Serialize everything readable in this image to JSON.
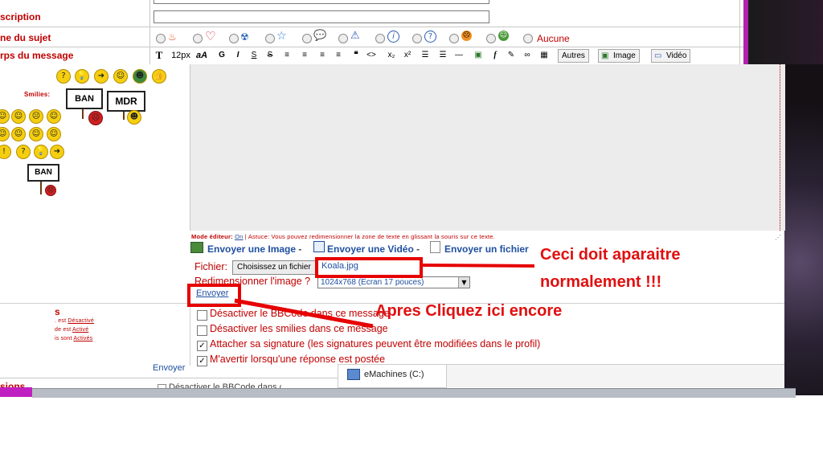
{
  "form": {
    "labels": {
      "description": "scription",
      "icon": "ne du sujet",
      "body": "rps du message",
      "smilies": "Smilies:",
      "options": "s",
      "options2": "sions"
    },
    "icon_none_label": "Aucune",
    "left_status": {
      "line1_prefix": ". est",
      "line1_link": "Désactivé",
      "line2_prefix": "de est",
      "line2_link": "Activé",
      "line3_prefix": "is sont",
      "line3_link": "Activés"
    },
    "envoyer_bottom": "Envoyer",
    "bottom_partial": "Désactiver le BBCode dans ce"
  },
  "toolbar": {
    "font_size": "12px",
    "bold": "G",
    "italic": "I",
    "underline": "S",
    "strike": "S",
    "others": "Autres",
    "image": "Image",
    "video": "Vidéo"
  },
  "smilies": {
    "ban": "BAN",
    "mdr": "MDR"
  },
  "editor": {
    "mode_label": "Mode éditeur:",
    "mode_value": "On",
    "tip": "Astuce: Vous pouvez redimensionner la zone de texte en glissant la souris sur ce texte.",
    "upload_image": "Envoyer une Image",
    "upload_video": "Envoyer une Vidéo",
    "upload_file": "Envoyer un fichier",
    "sep": "-",
    "file_label": "Fichier:",
    "choose_button": "Choisissez un fichier",
    "file_name": "Koala.jpg",
    "resize_label": "Redimensionner l'image ?",
    "resize_value": "1024x768 (Ecran 17 pouces)",
    "send_link": "Envoyer"
  },
  "options": [
    {
      "label": "Désactiver le BBCode dans ce message",
      "checked": false
    },
    {
      "label": "Désactiver les smilies dans ce message",
      "checked": false
    },
    {
      "label": "Attacher sa signature (les signatures peuvent être modifiées dans le profil)",
      "checked": true
    },
    {
      "label": "M'avertir lorsqu'une réponse est postée",
      "checked": true
    }
  ],
  "taskbar": {
    "drive": "eMachines (C:)"
  },
  "annotations": {
    "box_note_1": "Ceci doit aparaitre",
    "box_note_2": "normalement !!!",
    "click_note": "Apres Cliquez ici encore"
  },
  "colors": {
    "label_red": "#c00000",
    "annotation_red": "#e60000",
    "link_blue": "#1f4fa0"
  }
}
